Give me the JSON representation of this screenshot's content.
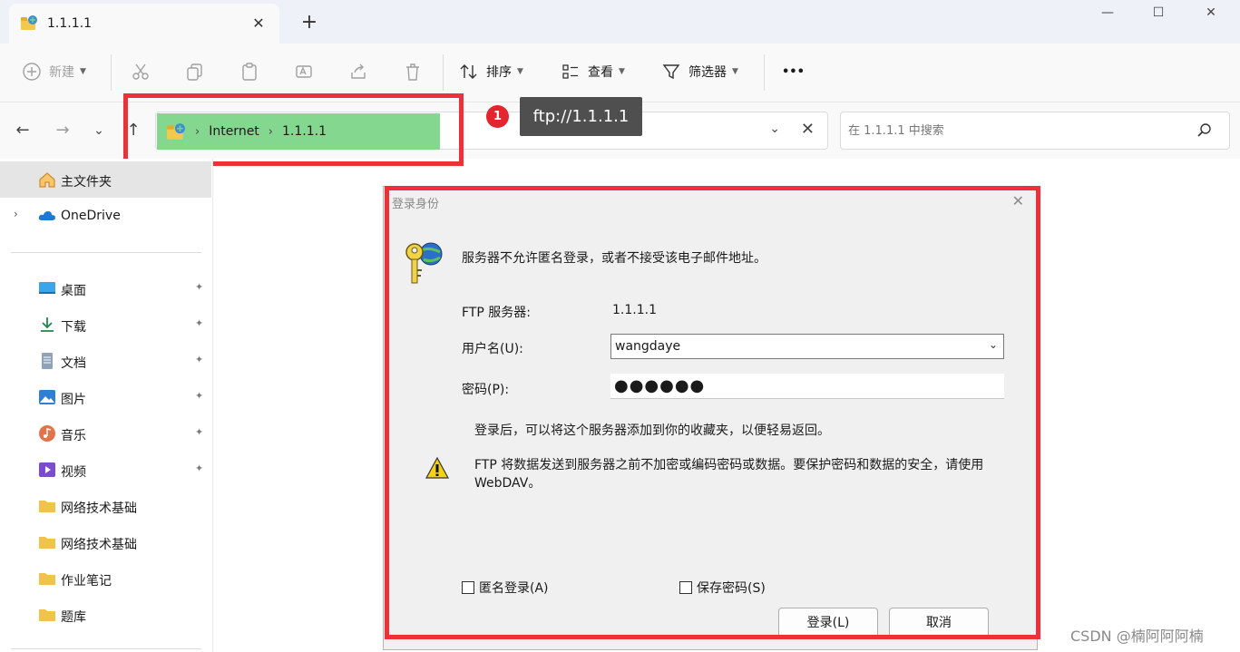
{
  "tab": {
    "title": "1.1.1.1",
    "close_glyph": "✕",
    "new_glyph": "+"
  },
  "window": {
    "minimize": "—",
    "maximize": "☐",
    "close": "✕"
  },
  "toolbar": {
    "new_label": "新建",
    "sort_label": "排序",
    "view_label": "查看",
    "filter_label": "筛选器",
    "more_glyph": "•••"
  },
  "nav": {
    "back": "←",
    "forward": "→",
    "recent": "⌄",
    "up": "↑",
    "crumbs": [
      "Internet",
      "1.1.1.1"
    ],
    "crumb_sep": "›",
    "dropdown_glyph": "⌄",
    "clear_glyph": "✕",
    "search_placeholder": "在 1.1.1.1 中搜索"
  },
  "annotation": {
    "badge": "1",
    "tooltip": "ftp://1.1.1.1"
  },
  "sidebar": {
    "home": "主文件夹",
    "onedrive": "OneDrive",
    "chevron": "›",
    "pin_glyph": "📌",
    "items": [
      "桌面",
      "下载",
      "文档",
      "图片",
      "音乐",
      "视频",
      "网络技术基础",
      "网络技术基础",
      "作业笔记",
      "题库"
    ]
  },
  "dialog": {
    "title": "登录身份",
    "close": "✕",
    "message": "服务器不允许匿名登录，或者不接受该电子邮件地址。",
    "server_label": "FTP 服务器:",
    "server_value": "1.1.1.1",
    "user_label": "用户名(U):",
    "user_value": "wangdaye",
    "select_arrow": "⌄",
    "password_label": "密码(P):",
    "password_value": "●●●●●●",
    "info": "登录后，可以将这个服务器添加到你的收藏夹，以便轻易返回。",
    "warning": "FTP 将数据发送到服务器之前不加密或编码密码或数据。要保护密码和数据的安全，请使用 WebDAV。",
    "anonymous_label": "匿名登录(A)",
    "save_password_label": "保存密码(S)",
    "login_button": "登录(L)",
    "cancel_button": "取消"
  },
  "watermark": "CSDN @楠阿阿阿楠",
  "colors": {
    "highlight": "#83d78e",
    "annotation_red": "#ec3238",
    "tooltip_bg": "#4f4f4f"
  }
}
